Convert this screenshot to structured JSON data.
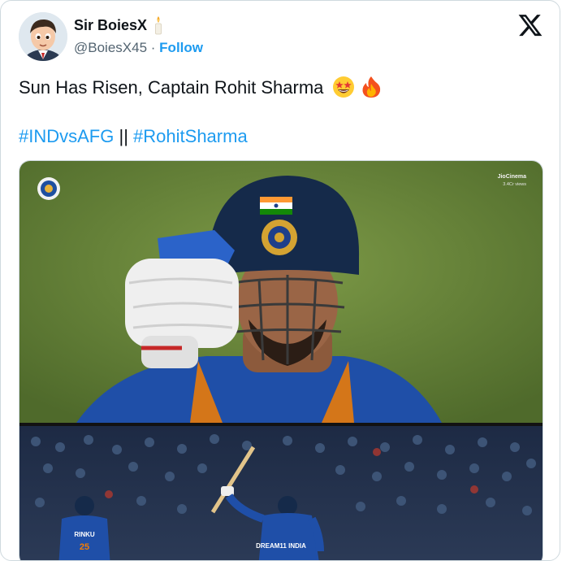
{
  "author": {
    "display_name": "Sir BoiesX",
    "handle": "@BoiesX45",
    "separator": "·",
    "follow_label": "Follow"
  },
  "tweet": {
    "text": "Sun Has Risen, Captain Rohit Sharma",
    "emojis": [
      "star-struck",
      "fire"
    ],
    "hashtag_1": "#INDvsAFG",
    "hashtag_separator": "||",
    "hashtag_2": "#RohitSharma"
  },
  "media": {
    "broadcaster_logo": "JioCinema",
    "view_count": "3.4Cr views",
    "jersey_name": "RINKU",
    "jersey_number": "25",
    "jersey_text": "DREAM11 INDIA"
  },
  "colors": {
    "link_blue": "#1d9bf0",
    "text_dark": "#0f1419",
    "text_muted": "#536471",
    "pitch_green": "#6b8a3c",
    "india_blue": "#1f4fa8"
  }
}
